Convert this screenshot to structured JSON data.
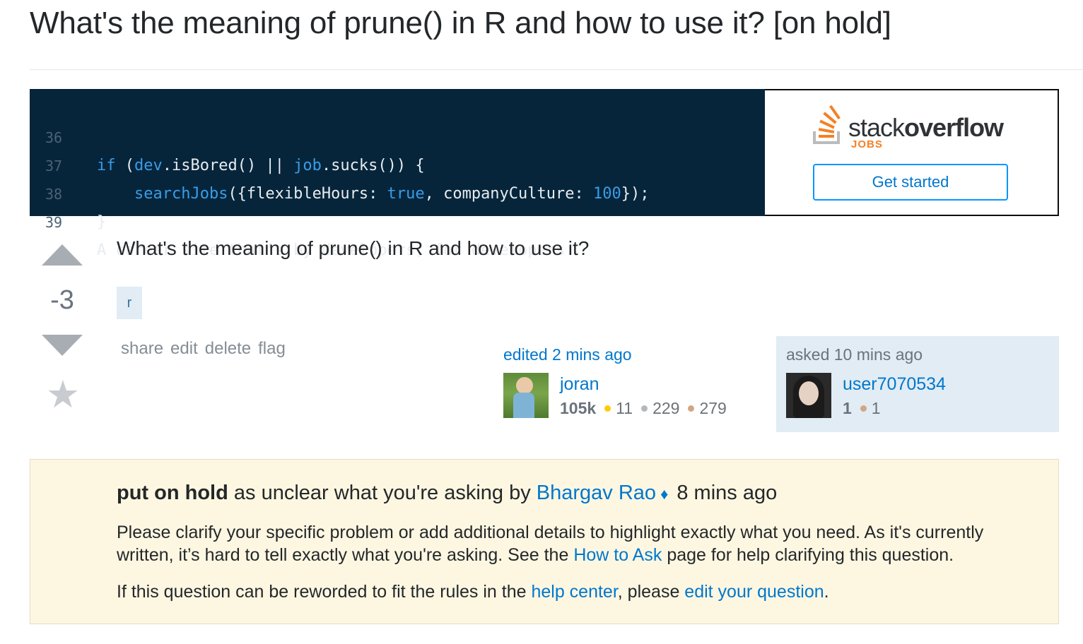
{
  "page": {
    "title": "What's the meaning of prune() in R and how to use it? [on hold]"
  },
  "ad": {
    "code_lines": [
      {
        "num": "36",
        "parts": [
          "if",
          " (",
          "dev",
          ".isBored() || ",
          "job",
          ".sucks()) {"
        ]
      },
      {
        "num": "37",
        "parts": [
          "    ",
          "searchJobs",
          "({flexibleHours: ",
          "true",
          ", companyCulture: ",
          "100",
          "});"
        ]
      },
      {
        "num": "38",
        "parts": [
          "}"
        ]
      },
      {
        "num": "39",
        "parts": [
          "A career site that’s by developers, for developers."
        ]
      }
    ],
    "logo_stack": "stack",
    "logo_overflow": "overflow",
    "logo_jobs": "JOBS",
    "cta_label": "Get started",
    "accent": "#f48024"
  },
  "question": {
    "vote_count": "-3",
    "body": "What's the meaning of prune() in R and how to use it?",
    "tags": [
      "r"
    ],
    "menu": [
      "share",
      "edit",
      "delete",
      "flag"
    ]
  },
  "editor": {
    "label": "edited 2 mins ago",
    "name": "joran",
    "rep": "105k",
    "gold": "11",
    "silver": "229",
    "bronze": "279"
  },
  "asker": {
    "label": "asked 10 mins ago",
    "name": "user7070534",
    "rep": "1",
    "bronze": "1"
  },
  "hold": {
    "status": "put on hold",
    "reason": " as unclear what you're asking by ",
    "moderator": "Bhargav Rao",
    "time": " 8 mins ago",
    "p1_a": "Please clarify your specific problem or add additional details to highlight exactly what you need. As it's currently written, it’s hard to tell exactly what you're asking. See the ",
    "p1_link": "How to Ask",
    "p1_b": " page for help clarifying this question.",
    "p2_a": "If this question can be reworded to fit the rules in the ",
    "p2_link1": "help center",
    "p2_b": ", please ",
    "p2_link2": "edit your question",
    "p2_c": "."
  },
  "colors": {
    "link": "#0077cc",
    "code_bg": "#06253b",
    "hold_bg": "#fdf7e2",
    "owner_bg": "#e1ecf4"
  }
}
